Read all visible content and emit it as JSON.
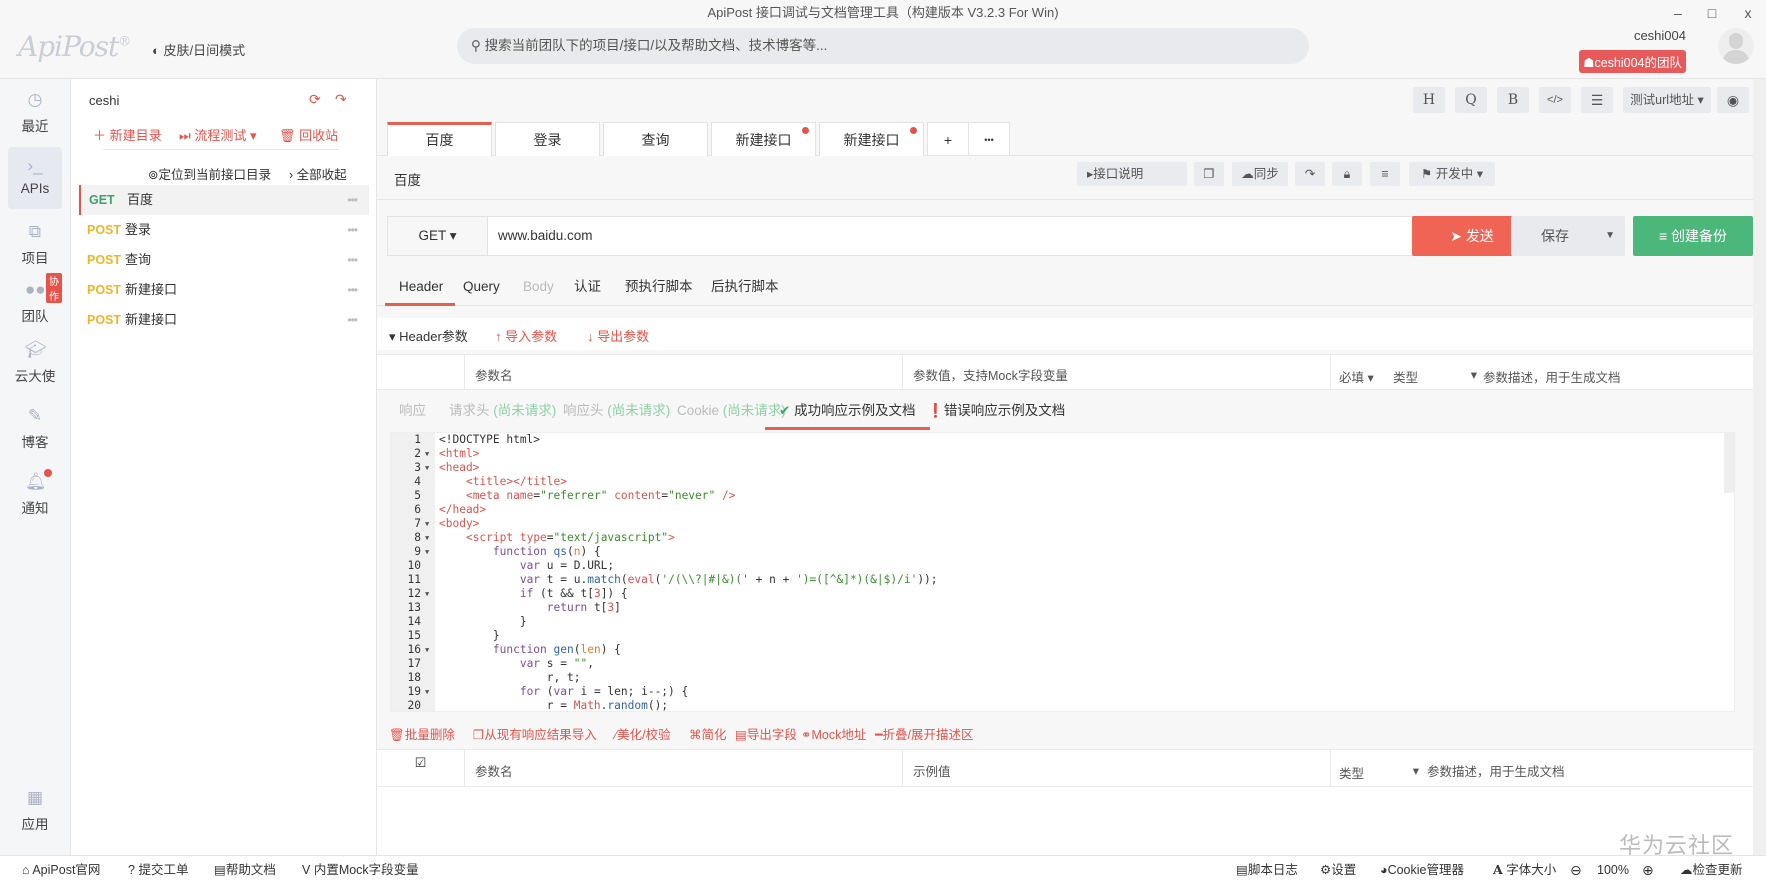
{
  "window": {
    "title": "ApiPost 接口调试与文档管理工具（构建版本 V3.2.3 For Win)",
    "minimize": "–",
    "maximize": "□",
    "close": "x"
  },
  "header": {
    "logo": "ApiPost",
    "logo_mark": "®",
    "skin_toggle": "皮肤/日间模式",
    "search_placeholder": "搜索当前团队下的项目/接口/以及帮助文档、技术博客等...",
    "username": "ceshi004",
    "team": "ceshi004的团队"
  },
  "nav": {
    "items": [
      {
        "label": "最近",
        "icon": "clock-icon"
      },
      {
        "label": "APIs",
        "icon": "terminal-icon",
        "active": true
      },
      {
        "label": "项目",
        "icon": "projects-icon"
      },
      {
        "label": "团队",
        "icon": "team-icon",
        "badge": "协作"
      },
      {
        "label": "云大使",
        "icon": "graduation-cap-icon"
      },
      {
        "label": "博客",
        "icon": "edit-icon"
      },
      {
        "label": "通知",
        "icon": "bell-icon"
      }
    ],
    "bottom": {
      "label": "应用",
      "icon": "apps-icon"
    }
  },
  "tree": {
    "project": "ceshi",
    "new_dir": "新建目录",
    "flow_test": "流程测试",
    "recycle": "回收站",
    "locate": "定位到当前接口目录",
    "collapse_all": "全部收起",
    "items": [
      {
        "method": "GET",
        "name": "百度",
        "active": true
      },
      {
        "method": "POST",
        "name": "登录"
      },
      {
        "method": "POST",
        "name": "查询"
      },
      {
        "method": "POST",
        "name": "新建接口"
      },
      {
        "method": "POST",
        "name": "新建接口"
      }
    ]
  },
  "toolbar": {
    "h": "H",
    "q": "Q",
    "b": "B",
    "code": "</>",
    "settings": "☰",
    "env": "测试url地址"
  },
  "tabs": [
    {
      "label": "百度",
      "active": true
    },
    {
      "label": "登录"
    },
    {
      "label": "查询"
    },
    {
      "label": "新建接口",
      "dot": true
    },
    {
      "label": "新建接口",
      "dot": true
    }
  ],
  "tab_add": "+",
  "tab_more": "•••",
  "request": {
    "name": "百度",
    "doc_btn": "接口说明",
    "sync_btn": "同步",
    "status": "开发中",
    "method": "GET",
    "url": "www.baidu.com",
    "send": "发送",
    "save": "保存",
    "backup": "创建备份"
  },
  "subtabs": [
    {
      "label": "Header",
      "active": true
    },
    {
      "label": "Query"
    },
    {
      "label": "Body",
      "disabled": true
    },
    {
      "label": "认证"
    },
    {
      "label": "预执行脚本"
    },
    {
      "label": "后执行脚本"
    }
  ],
  "params": {
    "title": "Header参数",
    "import": "导入参数",
    "export": "导出参数",
    "col_name": "参数名",
    "col_value": "参数值，支持Mock字段变量",
    "col_required": "必填",
    "col_type": "类型",
    "col_desc": "参数描述，用于生成文档"
  },
  "resp_tabs": [
    {
      "label": "响应"
    },
    {
      "label": "请求头",
      "note": "(尚未请求)"
    },
    {
      "label": "响应头",
      "note": "(尚未请求)"
    },
    {
      "label": "Cookie",
      "note": "(尚未请求)"
    },
    {
      "label": "成功响应示例及文档",
      "active": true
    },
    {
      "label": "错误响应示例及文档"
    }
  ],
  "code": [
    [
      [
        "<!DOCTYPE html>",
        ""
      ]
    ],
    [
      [
        "<html>",
        "tag"
      ]
    ],
    [
      [
        "<head>",
        "tag"
      ]
    ],
    [
      [
        "    ",
        ""
      ],
      [
        "<title></title>",
        "tag"
      ]
    ],
    [
      [
        "    ",
        ""
      ],
      [
        "<meta ",
        "tag"
      ],
      [
        "name",
        "attr"
      ],
      [
        "=",
        ""
      ],
      [
        "\"referrer\"",
        "str"
      ],
      [
        " ",
        ""
      ],
      [
        "content",
        "attr"
      ],
      [
        "=",
        ""
      ],
      [
        "\"never\"",
        "str"
      ],
      [
        " />",
        "tag"
      ]
    ],
    [
      [
        "</head>",
        "tag"
      ]
    ],
    [
      [
        "<body>",
        "tag"
      ]
    ],
    [
      [
        "    ",
        ""
      ],
      [
        "<script ",
        "tag"
      ],
      [
        "type",
        "attr"
      ],
      [
        "=",
        ""
      ],
      [
        "\"text/javascript\"",
        "str"
      ],
      [
        ">",
        "tag"
      ]
    ],
    [
      [
        "        ",
        ""
      ],
      [
        "function ",
        "kw"
      ],
      [
        "qs",
        "fn"
      ],
      [
        "(",
        ""
      ],
      [
        "n",
        "var"
      ],
      [
        ") {",
        ""
      ]
    ],
    [
      [
        "            ",
        ""
      ],
      [
        "var ",
        "kw"
      ],
      [
        "u = D.URL;",
        ""
      ]
    ],
    [
      [
        "            ",
        ""
      ],
      [
        "var ",
        "kw"
      ],
      [
        "t = u.",
        ""
      ],
      [
        "match",
        "fn"
      ],
      [
        "(",
        ""
      ],
      [
        "eval",
        "num"
      ],
      [
        "(",
        ""
      ],
      [
        "'/(\\\\?|#|&)('",
        "str"
      ],
      [
        " + n + ",
        ""
      ],
      [
        "')=([^&]*)(&|$)/i'",
        "str"
      ],
      [
        "));",
        ""
      ]
    ],
    [
      [
        "            ",
        ""
      ],
      [
        "if ",
        "kw"
      ],
      [
        "(t && t[",
        ""
      ],
      [
        "3",
        "num"
      ],
      [
        "]) {",
        ""
      ]
    ],
    [
      [
        "                ",
        ""
      ],
      [
        "return ",
        "kw"
      ],
      [
        "t[",
        ""
      ],
      [
        "3",
        "num"
      ],
      [
        "]",
        ""
      ]
    ],
    [
      [
        "            }",
        ""
      ]
    ],
    [
      [
        "        }",
        ""
      ]
    ],
    [
      [
        "        ",
        ""
      ],
      [
        "function ",
        "kw"
      ],
      [
        "gen",
        "fn"
      ],
      [
        "(",
        ""
      ],
      [
        "len",
        "var"
      ],
      [
        ") {",
        ""
      ]
    ],
    [
      [
        "            ",
        ""
      ],
      [
        "var ",
        "kw"
      ],
      [
        "s = ",
        ""
      ],
      [
        "\"\"",
        "str"
      ],
      [
        ",",
        ""
      ]
    ],
    [
      [
        "                r, t;",
        ""
      ]
    ],
    [
      [
        "            ",
        ""
      ],
      [
        "for ",
        "kw"
      ],
      [
        "(",
        ""
      ],
      [
        "var ",
        "kw"
      ],
      [
        "i = len; i--;) {",
        ""
      ]
    ],
    [
      [
        "                r = ",
        ""
      ],
      [
        "Math",
        "num"
      ],
      [
        ".",
        ""
      ],
      [
        "random",
        "fn"
      ],
      [
        "();",
        ""
      ]
    ]
  ],
  "code_folds": [
    2,
    3,
    7,
    8,
    9,
    12,
    16,
    19
  ],
  "resp_actions": [
    "批量删除",
    "从现有响应结果导入",
    "美化/校验",
    "简化",
    "导出字段",
    "Mock地址",
    "折叠/展开描述区"
  ],
  "resp_table": {
    "col_name": "参数名",
    "col_example": "示例值",
    "col_type": "类型",
    "col_desc": "参数描述，用于生成文档"
  },
  "footer": {
    "left": [
      "ApiPost官网",
      "提交工单",
      "帮助文档",
      "内置Mock字段变量"
    ],
    "script_log": "脚本日志",
    "settings": "设置",
    "cookie": "Cookie管理器",
    "font_size": "字体大小",
    "zoom": "100%",
    "check_update": "检查更新"
  },
  "watermark": "华为云社区",
  "colors": {
    "accent": "#e5604f",
    "get": "#3ea36b",
    "post": "#f0b429",
    "backup": "#4cb77a"
  }
}
